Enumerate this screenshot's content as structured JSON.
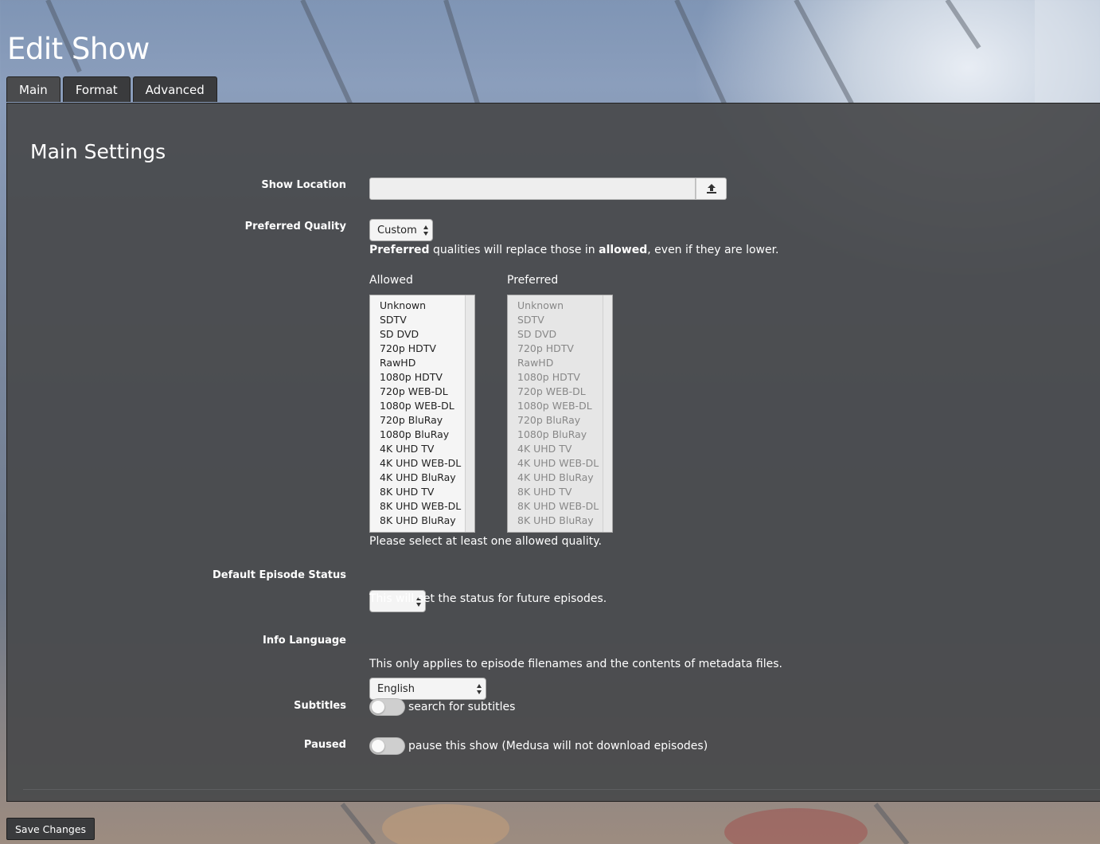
{
  "page": {
    "title": "Edit Show"
  },
  "tabs": [
    {
      "label": "Main",
      "active": true
    },
    {
      "label": "Format",
      "active": false
    },
    {
      "label": "Advanced",
      "active": false
    }
  ],
  "main_settings": {
    "title": "Main Settings",
    "show_location": {
      "label": "Show Location",
      "value": "",
      "button_icon": "upload-icon"
    },
    "preferred_quality": {
      "label": "Preferred Quality",
      "selected": "Custom",
      "help_bold_1": "Preferred",
      "help_mid": " qualities will replace those in ",
      "help_bold_2": "allowed",
      "help_end": ", even if they are lower.",
      "allowed_label": "Allowed",
      "preferred_label": "Preferred",
      "qualities": [
        "Unknown",
        "SDTV",
        "SD DVD",
        "720p HDTV",
        "RawHD",
        "1080p HDTV",
        "720p WEB-DL",
        "1080p WEB-DL",
        "720p BluRay",
        "1080p BluRay",
        "4K UHD TV",
        "4K UHD WEB-DL",
        "4K UHD BluRay",
        "8K UHD TV",
        "8K UHD WEB-DL",
        "8K UHD BluRay"
      ],
      "warning": "Please select at least one allowed quality."
    },
    "default_episode_status": {
      "label": "Default Episode Status",
      "selected": "",
      "help": "This will set the status for future episodes."
    },
    "info_language": {
      "label": "Info Language",
      "selected": "English",
      "help": "This only applies to episode filenames and the contents of metadata files."
    },
    "subtitles": {
      "label": "Subtitles",
      "text": "search for subtitles",
      "enabled": false
    },
    "paused": {
      "label": "Paused",
      "text": "pause this show (Medusa will not download episodes)",
      "enabled": false
    }
  },
  "footer": {
    "save_label": "Save Changes"
  }
}
